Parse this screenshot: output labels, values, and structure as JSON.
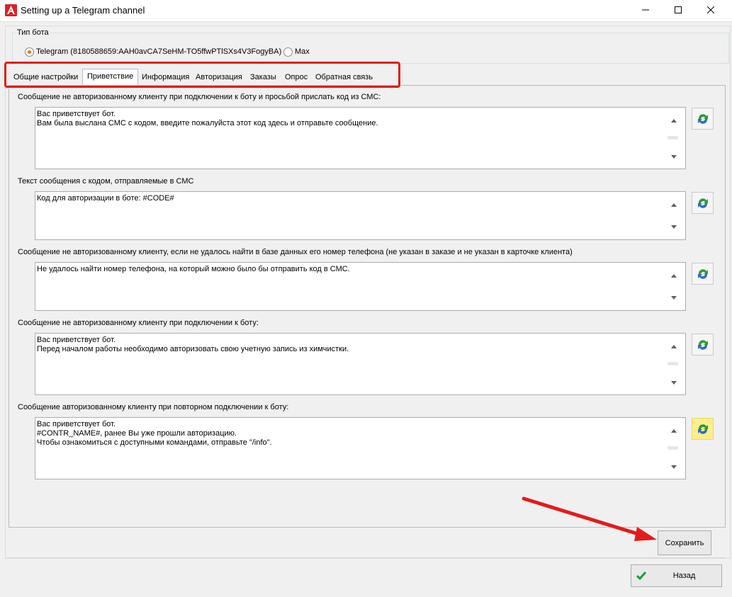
{
  "window": {
    "title": "Setting up a Telegram channel",
    "controls": [
      "minimize-icon",
      "maximize-icon",
      "close-icon"
    ]
  },
  "bot_type": {
    "legend": "Тип бота",
    "options": [
      {
        "label": "Telegram (8180588659:AAH0avCA7SeHM-TO5ffwPTlSXs4V3FogyBA)",
        "checked": true
      },
      {
        "label": "Max",
        "checked": false
      }
    ]
  },
  "tabs": [
    {
      "label": "Общие настройки",
      "active": false
    },
    {
      "label": "Приветствие",
      "active": true
    },
    {
      "label": "Информация",
      "active": false
    },
    {
      "label": "Авторизация",
      "active": false
    },
    {
      "label": "Заказы",
      "active": false
    },
    {
      "label": "Опрос",
      "active": false
    },
    {
      "label": "Обратная связь",
      "active": false
    }
  ],
  "sections": [
    {
      "label": "Сообщение не авторизованному клиенту при подключении к боту и просьбой прислать код из СМС:",
      "text": "Вас приветствует бот.\nВам была выслана СМС с кодом, введите пожалуйста этот код здесь и отправьте сообщение."
    },
    {
      "label": "Текст сообщения с кодом, отправляемые в СМС",
      "text": "Код для авторизации в боте: #CODE#"
    },
    {
      "label": "Сообщение не авторизованному клиенту, если не удалось найти в базе данных его номер телефона (не указан в заказе и не указан в карточке клиента)",
      "text": "Не удалось найти номер телефона, на который можно было бы отправить код в СМС."
    },
    {
      "label": "Сообщение не авторизованному клиенту при подключении к боту:",
      "text": "Вас приветствует бот.\nПеред началом работы необходимо авторизовать свою учетную запись из химчистки."
    },
    {
      "label": "Сообщение авторизованному клиенту при повторном подключении к боту:",
      "text": "Вас приветствует бот.\n#CONTR_NAME#, ранее Вы уже прошли авторизацию.\nЧтобы ознакомиться с доступными командами, отправьте \"/info\"."
    }
  ],
  "buttons": {
    "save": "Сохранить",
    "back": "Назад"
  },
  "colors": {
    "highlight": "#e31b1b",
    "radio_dot": "#e2741b",
    "hot_button": "#fbee8c"
  }
}
